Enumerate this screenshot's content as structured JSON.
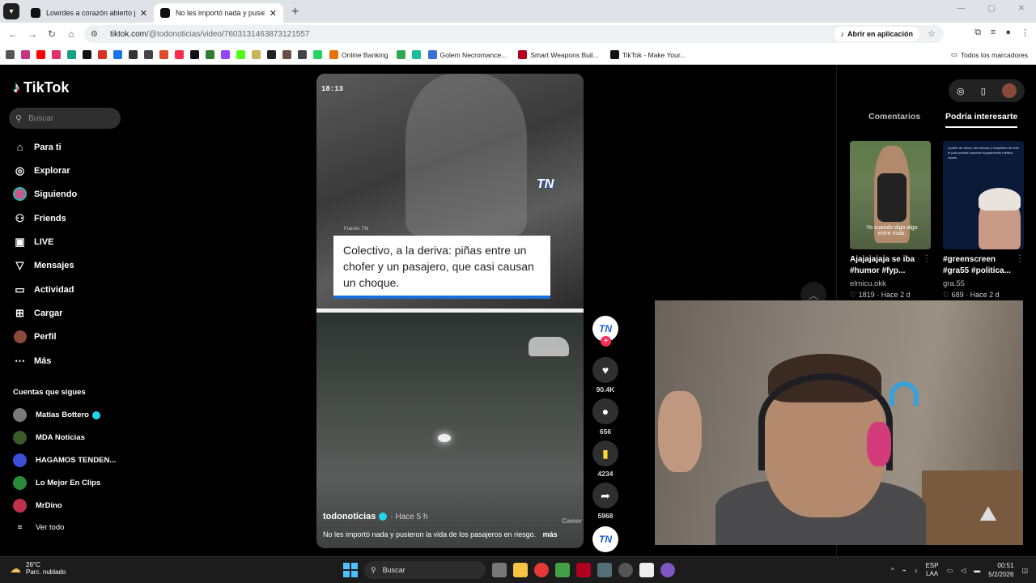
{
  "browser": {
    "tabs": [
      {
        "title": "Lowrdes a corazón abierto junt"
      },
      {
        "title": "No les importó nada y pusiero"
      }
    ],
    "url_domain": "tiktok.com",
    "url_path": "/@todonoticias/video/7603131463873121557",
    "open_app_label": "Abrir en aplicación",
    "bookmarks": [
      {
        "label": "Online Banking",
        "color": "#e8710a"
      },
      {
        "label": "Golem Necromance...",
        "color": "#3a6fd8"
      },
      {
        "label": "Smart Weapons Buil...",
        "color": "#b00020"
      },
      {
        "label": "TikTok - Make Your...",
        "color": "#111111"
      }
    ],
    "all_bookmarks_label": "Todos los marcadores"
  },
  "sidebar": {
    "logo_text": "TikTok",
    "search_placeholder": "Buscar",
    "nav": [
      {
        "label": "Para ti",
        "icon": "home-icon"
      },
      {
        "label": "Explorar",
        "icon": "compass-icon"
      },
      {
        "label": "Siguiendo",
        "icon": "following-avatar-icon"
      },
      {
        "label": "Friends",
        "icon": "friends-icon"
      },
      {
        "label": "LIVE",
        "icon": "live-icon"
      },
      {
        "label": "Mensajes",
        "icon": "send-icon"
      },
      {
        "label": "Actividad",
        "icon": "activity-icon"
      },
      {
        "label": "Cargar",
        "icon": "upload-icon"
      },
      {
        "label": "Perfil",
        "icon": "profile-icon"
      },
      {
        "label": "Más",
        "icon": "more-icon"
      }
    ],
    "following_title": "Cuentas que sigues",
    "following": [
      {
        "name": "Matias Bottero",
        "verified": true,
        "color": "#7a7a7a"
      },
      {
        "name": "MDA Noticias",
        "verified": false,
        "color": "#3a5a2a"
      },
      {
        "name": "HAGAMOS TENDEN...",
        "verified": false,
        "color": "#3b4fd8"
      },
      {
        "name": "Lo Mejor En Clips",
        "verified": false,
        "color": "#2a8a3a"
      },
      {
        "name": "MrDino",
        "verified": false,
        "color": "#c0304a"
      }
    ],
    "see_all": "Ver todo"
  },
  "video": {
    "timestamp": "18:13",
    "source": "Fuente: TN",
    "brand": "TN",
    "caption": "Colectivo, a la deriva: piñas entre un chofer y un pasajero, que casi causan un choque.",
    "author": "todonoticias",
    "posted": "· Hace 5 h",
    "description": "No les importó nada y pusieron la vida de los pasajeros en riesgo.",
    "more_label": "más",
    "watermark": "Camer"
  },
  "actions": {
    "likes": "90.4K",
    "comments": "656",
    "saves": "4234",
    "shares": "5968",
    "avatar_text": "TN"
  },
  "right_panel": {
    "tabs": [
      "Comentarios",
      "Podría interesarte"
    ],
    "active_tab": "Podría interesarte",
    "cards": [
      {
        "title": "Ajajajajaja se iba #humor #fyp...",
        "author": "elmicu.okk",
        "likes": "1819",
        "time": "· Hace 2 d",
        "overlay": "Yo cuando digo algo entre risas:"
      },
      {
        "title": "#greenscreen #gra55 #politica...",
        "author": "gra.55",
        "likes": "689",
        "time": "· Hace 2 d",
        "overlay": "A partir de ahora, las clínicas y hospitales de todo el país podrán importar equipamiento médico usado."
      }
    ]
  },
  "taskbar": {
    "temperature": "26°C",
    "weather_desc": "Parc. nublado",
    "search_label": "Buscar",
    "lang_top": "ESP",
    "lang_bottom": "LAA",
    "time": "00:51",
    "date": "5/2/2026"
  }
}
